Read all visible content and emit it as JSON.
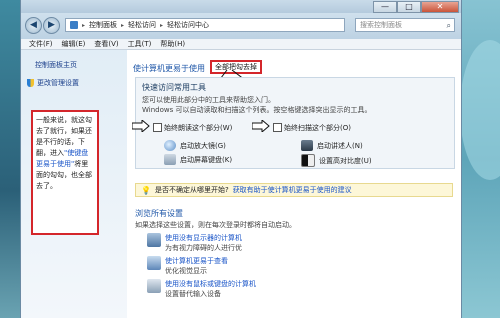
{
  "titlebar": {
    "min": "—",
    "max": "□",
    "close": "✕"
  },
  "address": {
    "back_icon": "back-arrow-icon",
    "crumbs": [
      "控制面板",
      "轻松访问",
      "轻松访问中心"
    ],
    "search_placeholder": "搜索控制面板"
  },
  "menu": [
    "文件(F)",
    "编辑(E)",
    "查看(V)",
    "工具(T)",
    "帮助(H)"
  ],
  "sidebar": {
    "home": "控制面板主页",
    "admin": "更改管理设置",
    "note_parts": [
      "一般来说，就这勾去了就行，如果还是不行的话，下翻，进入",
      "\"使键盘更易于使用\"",
      "将里面的勾勾，也全部去了。"
    ]
  },
  "main": {
    "title": "使计算机更易于使用",
    "annotation": "全部把勾去掉",
    "quick": {
      "title": "快速访问常用工具",
      "line1": "您可以使用此部分中的工具来帮助您入门。",
      "line2": "Windows 可以自动读取和扫描这个列表。按空格键选择突出显示的工具。",
      "cb1": "始终朗读这个部分(W)",
      "cb2": "始终扫描这个部分(O)"
    },
    "options": [
      {
        "label": "启动放大镜(G)",
        "icon": "magnifier-icon"
      },
      {
        "label": "启动讲述人(N)",
        "icon": "narrator-icon"
      },
      {
        "label": "启动屏幕键盘(K)",
        "icon": "keyboard-icon"
      },
      {
        "label": "设置高对比度(U)",
        "icon": "contrast-icon"
      }
    ],
    "tip": {
      "q": "是否不确定从哪里开始?",
      "link": "获取有助于使计算机更易于使用的建议"
    },
    "browse": {
      "title": "浏览所有设置",
      "sub": "如果选择这些设置，则在每次登录时都将自动启动。"
    },
    "items": [
      {
        "t1": "使用没有显示器的计算机",
        "t2": "为有视力障碍的人进行优"
      },
      {
        "t1": "使计算机更易于查看",
        "t2": "优化视觉显示"
      },
      {
        "t1": "使用没有鼠标或键盘的计算机",
        "t2": "设置替代输入设备"
      }
    ]
  }
}
